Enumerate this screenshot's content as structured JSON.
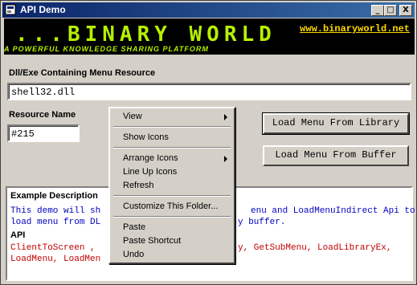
{
  "window": {
    "title": "API Demo",
    "minimize": "_",
    "maximize": "□",
    "close": "X"
  },
  "banner": {
    "logo": "...BINARY WORLD",
    "tagline": "A POWERFUL KNOWLEDGE SHARING PLATFORM",
    "url": "www.binaryworld.net"
  },
  "form": {
    "dll_label": "Dll/Exe Containing Menu Resource",
    "dll_value": "shell32.dll",
    "resource_label": "Resource Name",
    "resource_value": "#215",
    "load_library_button": "Load Menu From Library",
    "load_buffer_button": "Load Menu From Buffer"
  },
  "description": {
    "title": "Example Description",
    "line1_a": "This demo will sh",
    "line1_b": "enu and LoadMenuIndirect Api to",
    "line2_a": "load menu from DL",
    "line2_b": "y buffer.",
    "api_heading": "API",
    "api_line1_a": "ClientToScreen , ",
    "api_line1_b": "y, GetSubMenu, LoadLibraryEx,",
    "api_line2_a": "LoadMenu, LoadMen"
  },
  "context_menu": {
    "view": "View",
    "show_icons": "Show Icons",
    "arrange_icons": "Arrange Icons",
    "line_up_icons": "Line Up Icons",
    "refresh": "Refresh",
    "customize": "Customize This Folder...",
    "paste": "Paste",
    "paste_shortcut": "Paste Shortcut",
    "undo": "Undo"
  },
  "colors": {
    "banner_text": "#b6f000",
    "url_text": "#ffd800",
    "description_text": "#0000c0",
    "api_text": "#c00000"
  }
}
